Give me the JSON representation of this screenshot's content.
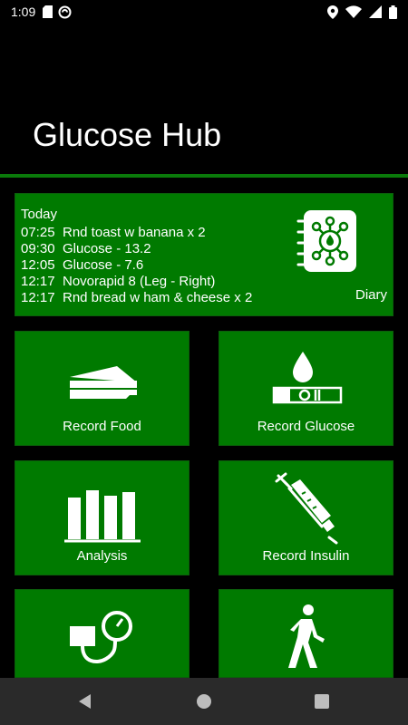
{
  "status_bar": {
    "time": "1:09"
  },
  "app": {
    "title": "Glucose Hub"
  },
  "diary": {
    "heading": "Today",
    "entries": [
      {
        "time": "07:25",
        "text": "Rnd toast w banana x 2"
      },
      {
        "time": "09:30",
        "text": "Glucose - 13.2"
      },
      {
        "time": "12:05",
        "text": "Glucose - 7.6"
      },
      {
        "time": "12:17",
        "text": "Novorapid 8 (Leg - Right)"
      },
      {
        "time": "12:17",
        "text": "Rnd bread w ham & cheese x 2"
      }
    ],
    "label": "Diary",
    "icon": "diary-notebook-icon"
  },
  "tiles": {
    "record_food": {
      "label": "Record Food",
      "icon": "sandwich-icon"
    },
    "record_glucose": {
      "label": "Record Glucose",
      "icon": "blood-drop-test-strip-icon"
    },
    "analysis": {
      "label": "Analysis",
      "icon": "bar-chart-icon"
    },
    "record_insulin": {
      "label": "Record Insulin",
      "icon": "syringe-icon"
    },
    "blood_pressure": {
      "icon": "blood-pressure-monitor-icon"
    },
    "activity": {
      "icon": "walking-person-icon"
    }
  },
  "colors": {
    "tile": "#007a00",
    "header_rule": "#0a7a0a",
    "background": "#000000",
    "nav": "#2a2a2a"
  }
}
